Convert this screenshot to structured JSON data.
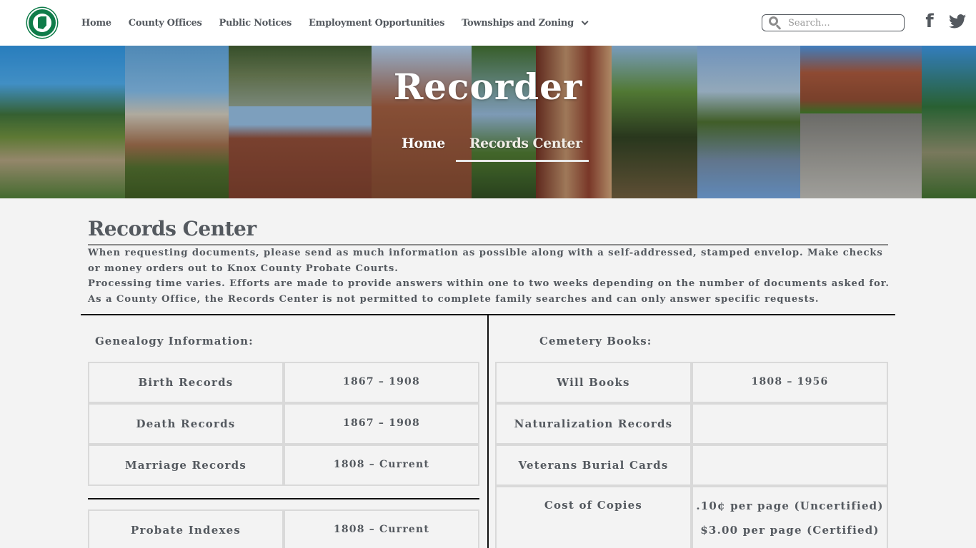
{
  "header": {
    "logo_alt": "county-seal",
    "nav": [
      {
        "label": "Home"
      },
      {
        "label": "County Offices"
      },
      {
        "label": "Public Notices"
      },
      {
        "label": "Employment Opportunities"
      },
      {
        "label": "Townships and Zoning",
        "has_dropdown": true
      }
    ],
    "search": {
      "placeholder": "Search...",
      "value": ""
    },
    "social": [
      {
        "icon": "facebook-icon",
        "glyph": "f"
      },
      {
        "icon": "twitter-icon"
      }
    ]
  },
  "banner": {
    "title": "Recorder",
    "breadcrumb": [
      {
        "label": "Home"
      },
      {
        "label": "Records Center"
      }
    ]
  },
  "content": {
    "title": "Records Center",
    "intro": [
      "When requesting documents, please send as much information as possible along with a self-addressed, stamped envelop. Make checks or money orders out to Knox County Probate Courts.",
      "Processing time varies. Efforts are made to provide answers within one to two weeks depending on the number of documents asked for.",
      "As a County Office, the Records Center is not permitted to complete family searches and can only answer specific requests."
    ],
    "left": {
      "label": "Genealogy Information:",
      "rows": [
        {
          "name": "Birth Records",
          "value": "1867 – 1908"
        },
        {
          "name": "Death Records",
          "value": "1867 – 1908"
        },
        {
          "name": "Marriage Records",
          "value": "1808 – Current"
        }
      ],
      "rows2": [
        {
          "name": "Probate Indexes",
          "value": "1808 – Current"
        }
      ]
    },
    "right": {
      "label": "Cemetery Books:",
      "rows": [
        {
          "name": "Will Books",
          "value": "1808 – 1956"
        },
        {
          "name": "Naturalization Records",
          "value": ""
        },
        {
          "name": "Veterans Burial Cards",
          "value": ""
        }
      ],
      "cost": {
        "name": "Cost of Copies",
        "values": [
          ".10¢ per page (Uncertified)",
          "$3.00 per page (Certified)"
        ]
      }
    }
  },
  "colors": {
    "brand_green": "#0f7c4a",
    "text": "#54595f",
    "background": "#f3f3f3",
    "cell_border": "#d9d9d9"
  }
}
